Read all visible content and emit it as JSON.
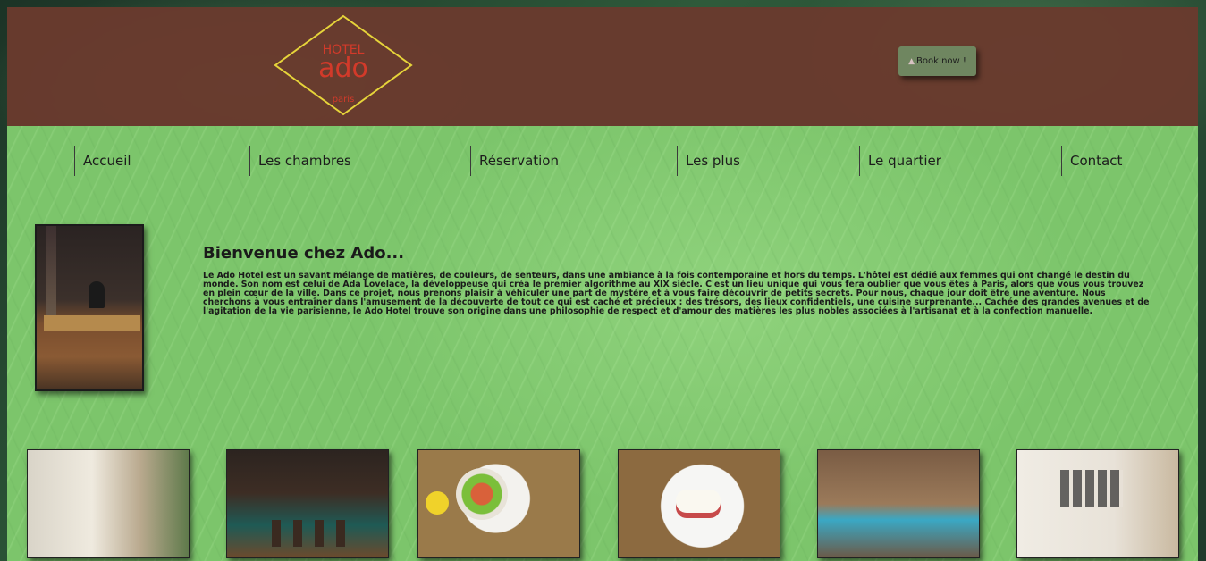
{
  "header": {
    "logo": {
      "line1": "HOTEL",
      "line2": "ado",
      "line3": "paris",
      "border_color": "#e6d43a",
      "text_color": "#d23a2a"
    },
    "book_button": {
      "icon": "bell-icon",
      "label": "Book now !"
    },
    "background_color": "#6a3a2e"
  },
  "nav": {
    "items": [
      {
        "label": "Accueil"
      },
      {
        "label": "Les chambres"
      },
      {
        "label": "Réservation"
      },
      {
        "label": "Les plus"
      },
      {
        "label": "Le quartier"
      },
      {
        "label": "Contact"
      }
    ]
  },
  "welcome": {
    "title": "Bienvenue chez Ado...",
    "text": "Le Ado Hotel est un savant mélange de matières, de couleurs, de senteurs, dans une ambiance à la fois contemporaine et hors du temps. L'hôtel est dédié aux femmes qui ont changé le destin du monde. Son nom est celui de Ada Lovelace, la développeuse qui créa le premier algorithme au XIX siècle. C'est un lieu unique qui vous fera oublier que vous êtes à Paris, alors que vous vous trouvez en plein cœur de la ville. Dans ce projet, nous prenons plaisir à véhiculer une part de mystère et à vous faire découvrir de petits secrets. Pour nous, chaque jour doit être une aventure. Nous cherchons à vous entraîner dans l'amusement de la découverte de tout ce qui est caché et précieux : des trésors, des lieux confidentiels, une cuisine surprenante... Cachée des grandes avenues et de l'agitation de la vie parisienne, le Ado Hotel trouve son origine dans une philosophie de respect et d'amour des matières les plus nobles associées à l'artisanat et à la confection manuelle."
  },
  "theme": {
    "main_background": "#7cc56b",
    "text_color": "#1a1a1a",
    "button_color": "#6f8660"
  }
}
